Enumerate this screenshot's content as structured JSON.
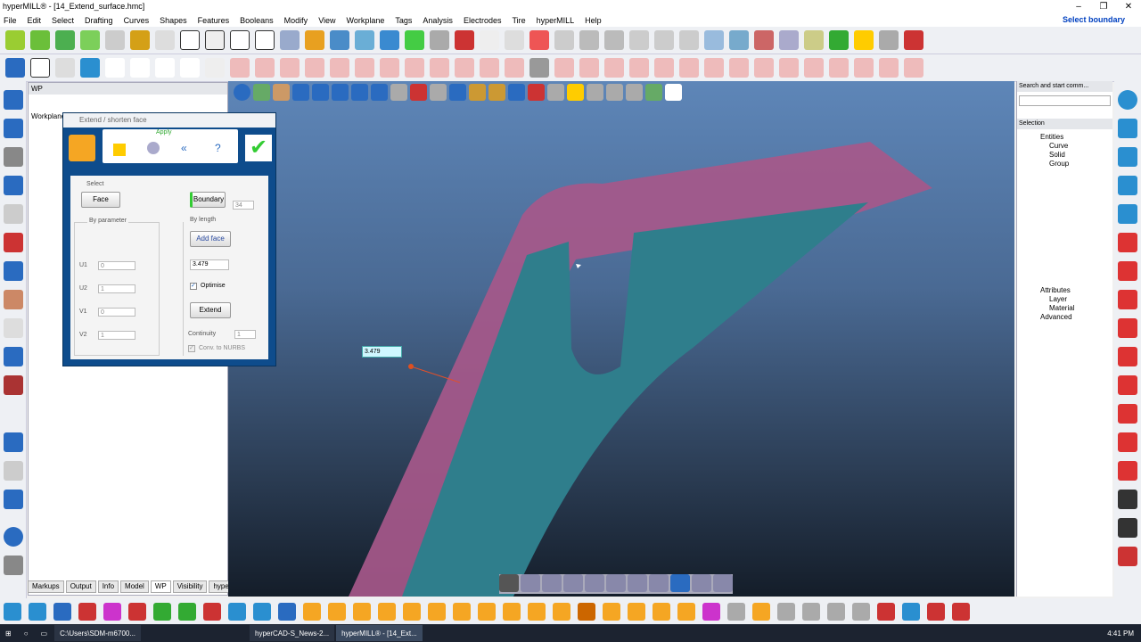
{
  "window": {
    "title": "hyperMILL® - [14_Extend_surface.hmc]",
    "min": "–",
    "max": "❐",
    "close": "✕"
  },
  "menu": [
    "File",
    "Edit",
    "Select",
    "Drafting",
    "Curves",
    "Shapes",
    "Features",
    "Booleans",
    "Modify",
    "View",
    "Workplane",
    "Tags",
    "Analysis",
    "Electrodes",
    "Tire",
    "hyperMILL",
    "Help"
  ],
  "menu_right": "Select boundary",
  "wp_panel": {
    "title": "WP",
    "tab": "Workplane"
  },
  "bottom_tabs": [
    "Markups",
    "Output",
    "Info",
    "Model",
    "WP",
    "Visibility",
    "hyperMILL"
  ],
  "dialog": {
    "title": "Extend / shorten face",
    "apply": "Apply",
    "select_label": "Select",
    "face_button": "Face",
    "boundary_button": "Boundary",
    "boundary_count": "34",
    "by_parameter": "By parameter",
    "by_length": "By length",
    "add_face": "Add face",
    "length_value": "3.479",
    "u1_label": "U1",
    "u1_value": "0",
    "u2_label": "U2",
    "u2_value": "1",
    "v1_label": "V1",
    "v1_value": "0",
    "v2_label": "V2",
    "v2_value": "1",
    "optimise": "Optimise",
    "extend": "Extend",
    "continuity": "Continuity",
    "continuity_value": "1",
    "conv_nurbs": "Conv. to NURBS"
  },
  "viewport": {
    "value_label": "3.479"
  },
  "search_panel": {
    "title": "Search and start comm..."
  },
  "selection_panel": {
    "title": "Selection",
    "entities": "Entities",
    "items": [
      "Curve",
      "Solid",
      "Group"
    ],
    "attributes": "Attributes",
    "attr_items": [
      "Layer",
      "Material"
    ],
    "advanced": "Advanced"
  },
  "taskbar": {
    "items": [
      "C:\\Users\\SDM-m6700...",
      "hyperCAD-S_News-2...",
      "hyperMILL® - [14_Ext..."
    ],
    "time": "4:41 PM"
  },
  "colors": {
    "surface_pink": "#b05c8c",
    "surface_teal": "#2e7d8c",
    "dialog_blue": "#0e4c8c"
  }
}
